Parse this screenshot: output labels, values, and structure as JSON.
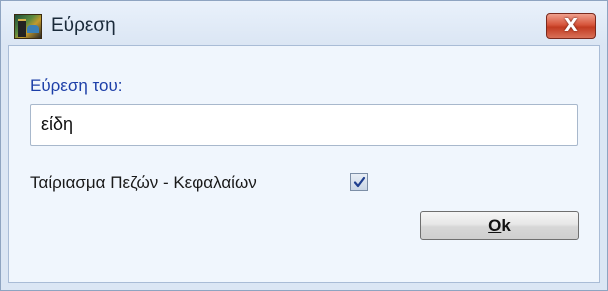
{
  "window": {
    "title": "Εύρεση",
    "close_glyph": "X"
  },
  "form": {
    "find_label": "Εύρεση του:",
    "search_value": "είδη",
    "match_case_label": "Ταίριασμα Πεζών - Κεφαλαίων",
    "match_case_checked": true
  },
  "buttons": {
    "ok_mnemonic": "O",
    "ok_rest": "k"
  },
  "icons": {
    "app": "app-logo-icon",
    "close": "close-icon",
    "check": "checkmark-icon"
  }
}
